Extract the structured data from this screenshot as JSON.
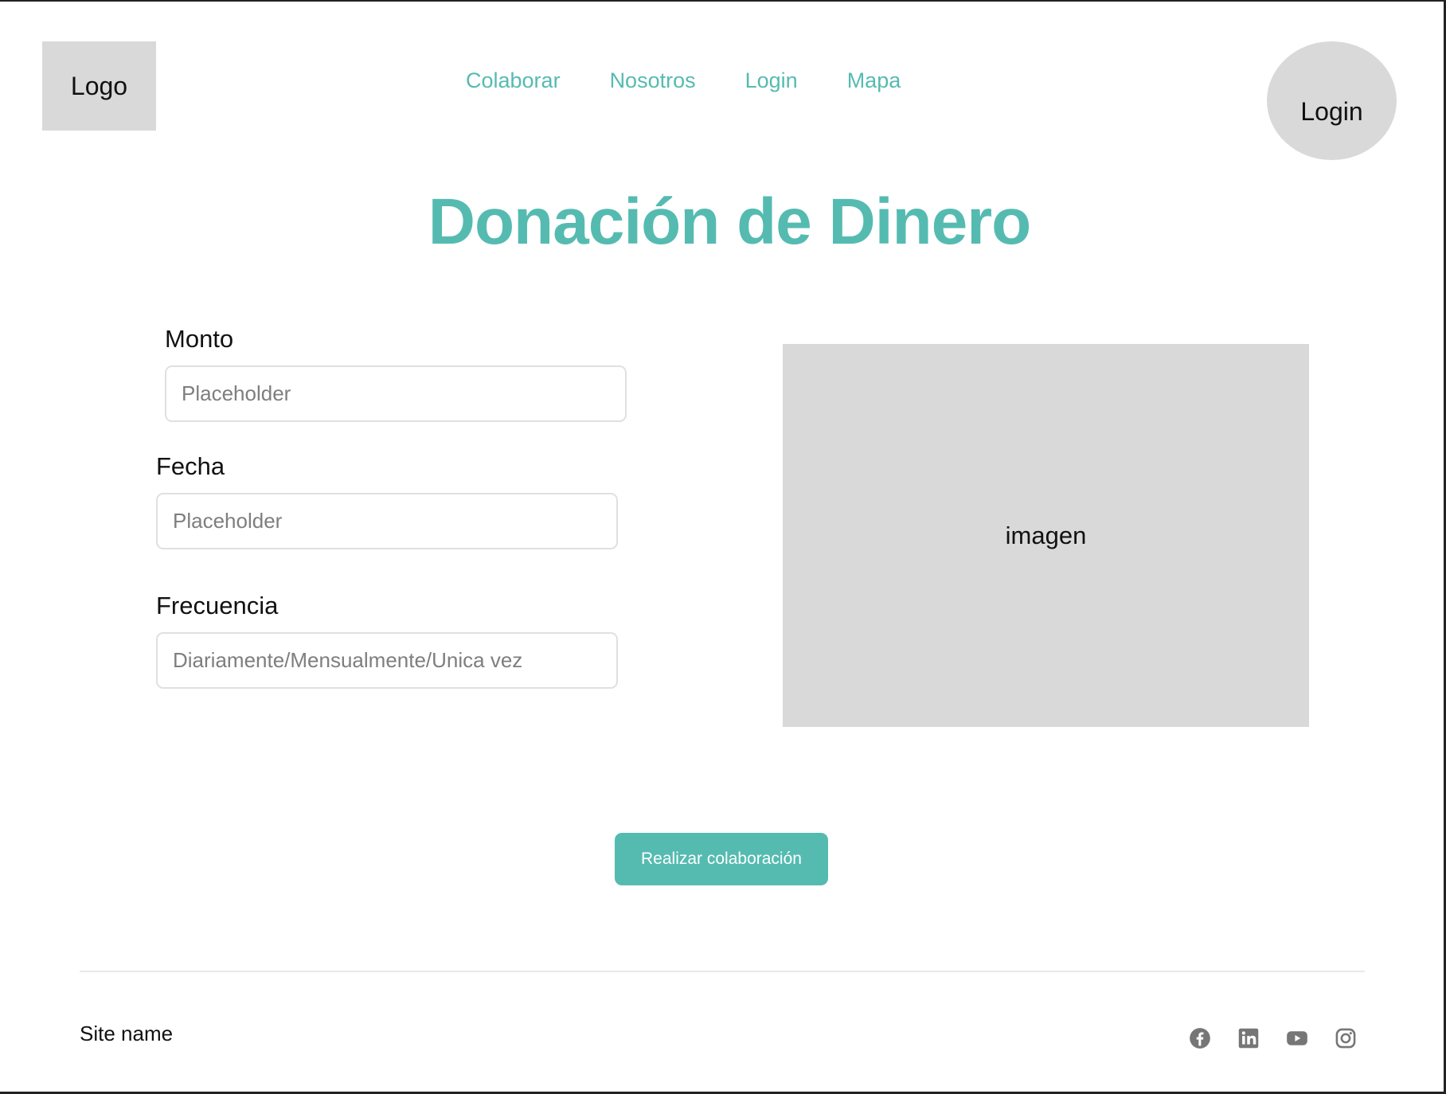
{
  "header": {
    "logo_text": "Logo",
    "nav": [
      {
        "label": "Colaborar"
      },
      {
        "label": "Nosotros"
      },
      {
        "label": "Login"
      },
      {
        "label": "Mapa"
      }
    ],
    "login_label": "Login"
  },
  "main": {
    "title": "Donación de Dinero",
    "fields": {
      "monto": {
        "label": "Monto",
        "placeholder": "Placeholder"
      },
      "fecha": {
        "label": "Fecha",
        "placeholder": "Placeholder"
      },
      "frecuencia": {
        "label": "Frecuencia",
        "placeholder": "Diariamente/Mensualmente/Unica vez"
      }
    },
    "image_label": "imagen",
    "submit_label": "Realizar colaboración"
  },
  "footer": {
    "site_name": "Site name",
    "social_icons": [
      "facebook-icon",
      "linkedin-icon",
      "youtube-icon",
      "instagram-icon"
    ]
  },
  "colors": {
    "accent": "#55bbb1",
    "placeholder_gray": "#d9d9d9",
    "icon_gray": "#767676"
  }
}
